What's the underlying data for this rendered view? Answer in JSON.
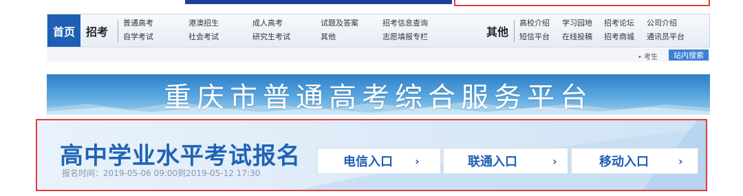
{
  "nav": {
    "home": "首页",
    "zhaokao": {
      "title": "招考",
      "links": [
        "普通高考",
        "自学考试",
        "港澳招生",
        "社会考试",
        "成人高考",
        "研究生考试",
        "试题及答案",
        "其他",
        "招考信息查询",
        "志愿填报专栏"
      ]
    },
    "other": {
      "title": "其他",
      "links": [
        "高校介绍",
        "短信平台",
        "学习园地",
        "在线投稿",
        "招考论坛",
        "招考商城",
        "公司介绍",
        "通讯员平台"
      ]
    }
  },
  "subbar": {
    "hint": "• 考生",
    "search": "站内搜索"
  },
  "banner": {
    "title": "重庆市普通高考综合服务平台"
  },
  "exam": {
    "title": "高中学业水平考试报名",
    "time": "报名时间：2019-05-06 09:00到2019-05-12 17:30",
    "entries": [
      "电信入口",
      "联通入口",
      "移动入口"
    ],
    "chevron": "›"
  },
  "colors": {
    "brand_blue": "#1e5fb4",
    "highlight_red": "#e03a3a",
    "banner_sky": "#2f7fc8"
  }
}
